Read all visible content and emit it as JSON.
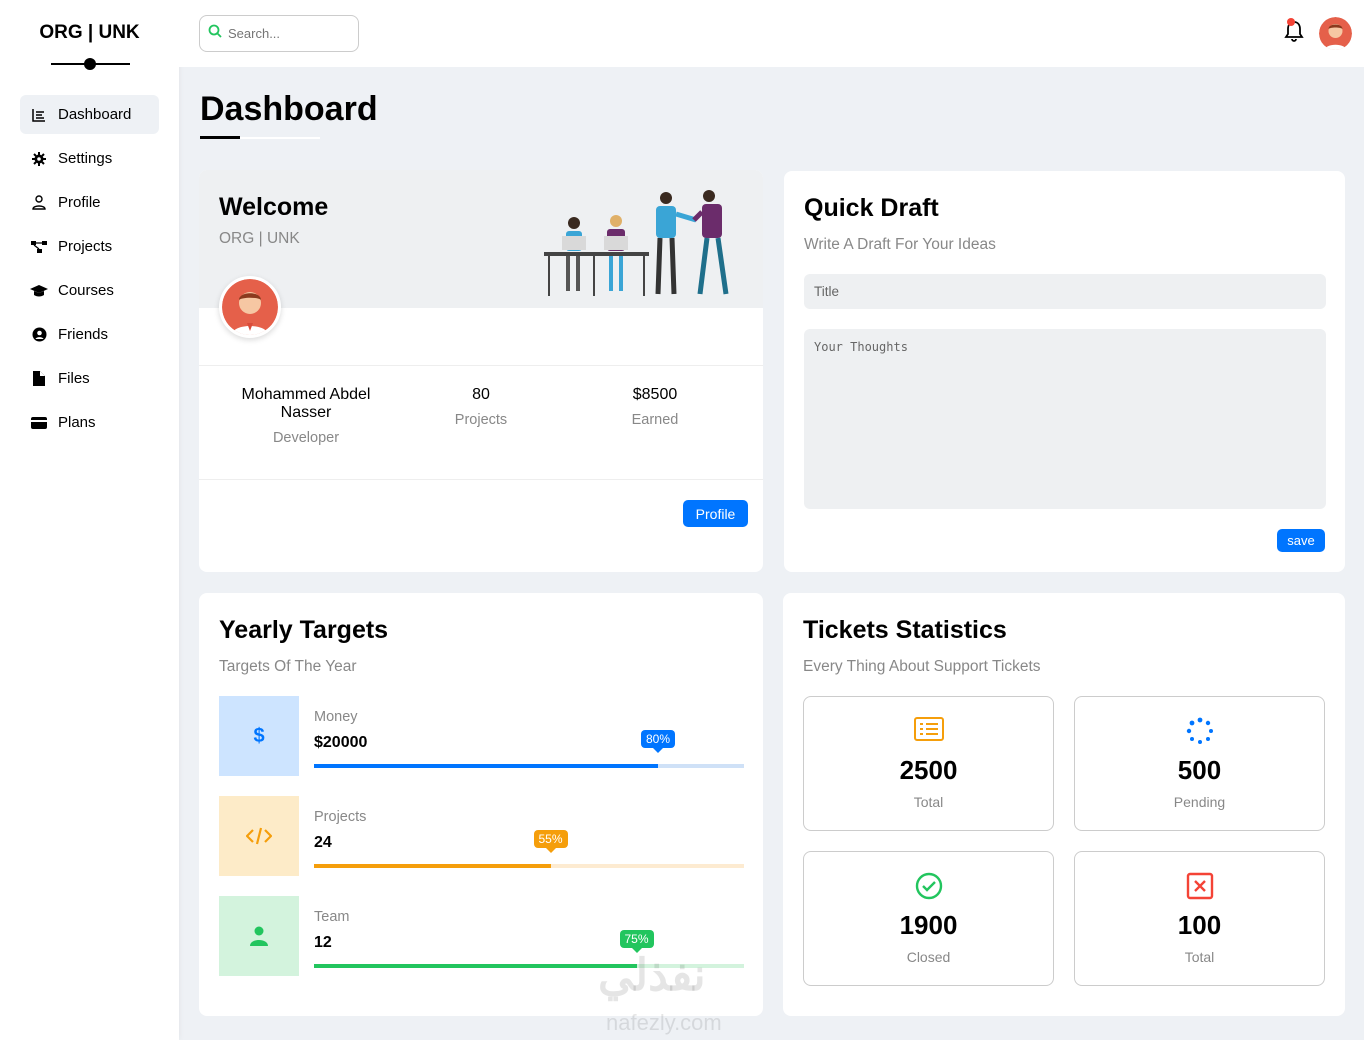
{
  "brand": {
    "logo_text": "ORG | UNK"
  },
  "sidebar": {
    "items": [
      {
        "label": "Dashboard",
        "icon": "chart-icon",
        "active": true
      },
      {
        "label": "Settings",
        "icon": "gear-icon"
      },
      {
        "label": "Profile",
        "icon": "user-icon"
      },
      {
        "label": "Projects",
        "icon": "diagram-icon"
      },
      {
        "label": "Courses",
        "icon": "graduation-cap-icon"
      },
      {
        "label": "Friends",
        "icon": "user-circle-icon"
      },
      {
        "label": "Files",
        "icon": "file-icon"
      },
      {
        "label": "Plans",
        "icon": "credit-card-icon"
      }
    ]
  },
  "topbar": {
    "search_placeholder": "Search..."
  },
  "page": {
    "title": "Dashboard"
  },
  "welcome": {
    "title": "Welcome",
    "subtitle": "ORG | UNK",
    "name": "Mohammed Abdel Nasser",
    "role": "Developer",
    "projects_value": "80",
    "projects_label": "Projects",
    "earned_value": "$8500",
    "earned_label": "Earned",
    "profile_button": "Profile"
  },
  "quick_draft": {
    "title": "Quick Draft",
    "subtitle": "Write A Draft For Your Ideas",
    "title_placeholder": "Title",
    "thoughts_placeholder": "Your Thoughts",
    "save_button": "save"
  },
  "targets": {
    "title": "Yearly Targets",
    "subtitle": "Targets Of The Year",
    "items": [
      {
        "label": "Money",
        "value": "$20000",
        "percent_text": "80%",
        "progress": 0.8,
        "icon": "dollar-icon",
        "color": "#0075ff",
        "bg": "#cde4ff",
        "track": "#cfe1f7"
      },
      {
        "label": "Projects",
        "value": "24",
        "percent_text": "55%",
        "progress": 0.55,
        "icon": "code-icon",
        "color": "#f59e0b",
        "bg": "#fdebc8",
        "track": "#fdebd1"
      },
      {
        "label": "Team",
        "value": "12",
        "percent_text": "75%",
        "progress": 0.75,
        "icon": "user-icon",
        "color": "#22c55e",
        "bg": "#d3f3dd",
        "track": "#d3f3dd"
      }
    ]
  },
  "tickets": {
    "title": "Tickets Statistics",
    "subtitle": "Every Thing About Support Tickets",
    "items": [
      {
        "value": "2500",
        "label": "Total",
        "icon": "list-icon",
        "color": "#f59e0b"
      },
      {
        "value": "500",
        "label": "Pending",
        "icon": "spinner-icon",
        "color": "#0075ff"
      },
      {
        "value": "1900",
        "label": "Closed",
        "icon": "check-circle-icon",
        "color": "#22c55e"
      },
      {
        "value": "100",
        "label": "Total",
        "icon": "close-square-icon",
        "color": "#f44336"
      }
    ]
  },
  "watermark": {
    "arabic": "نفذلي",
    "latin": "nafezly.com"
  }
}
